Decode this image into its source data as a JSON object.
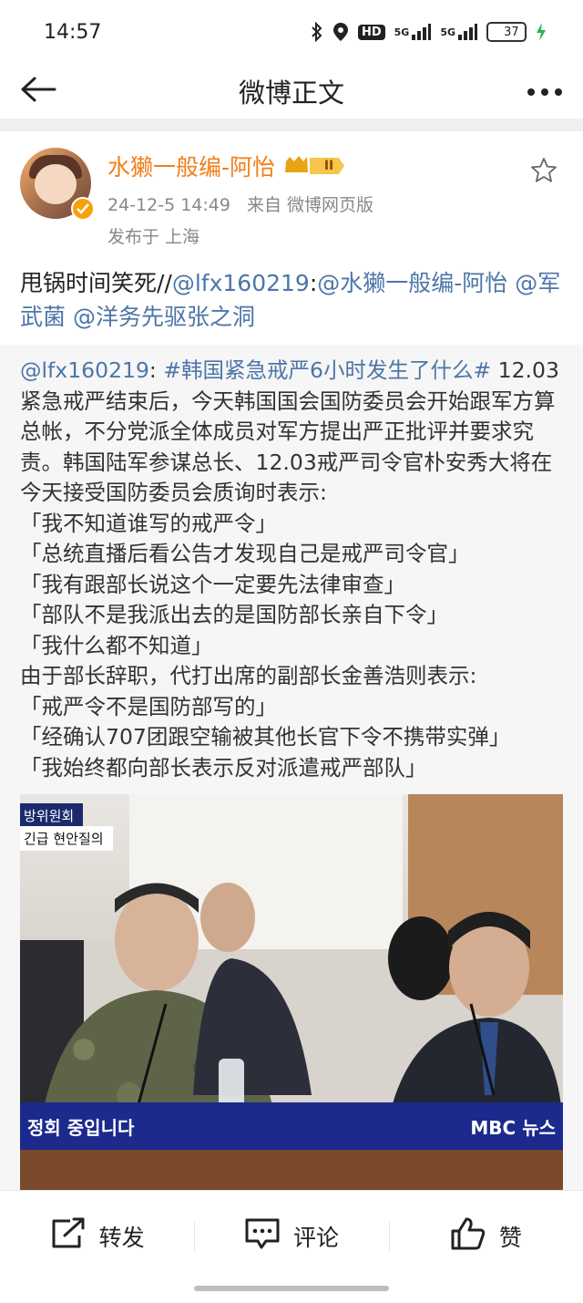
{
  "status_bar": {
    "time": "14:57",
    "hd_label": "HD",
    "net1": "5G",
    "net2": "5G",
    "battery": "37",
    "battery_level_pct": 37
  },
  "nav": {
    "title": "微博正文",
    "back_icon": "back-arrow-icon",
    "more_icon": "more-dots-icon"
  },
  "post": {
    "author_name": "水獭一般编-阿怡",
    "vip_level": "II",
    "timestamp": "24-12-5 14:49",
    "source": "来自 微博网页版",
    "location": "发布于 上海",
    "text_plain": "甩锅时间笑死//",
    "mention1": "@lfx160219",
    "sep1": ":",
    "mention2": "@水獭一般编-阿怡",
    "mention3": "@军武菌",
    "mention4": "@洋务先驱张之洞"
  },
  "repost": {
    "mention": "@lfx160219",
    "colon": ": ",
    "hashtag": "#韩国紧急戒严6小时发生了什么#",
    "body": " 12.03紧急戒严结束后，今天韩国国会国防委员会开始跟军方算总帐，不分党派全体成员对军方提出严正批评并要求究责。韩国陆军参谋总长、12.03戒严司令官朴安秀大将在今天接受国防委员会质询时表示:",
    "quotes1": [
      "「我不知道谁写的戒严令」",
      "「总统直播后看公告才发现自己是戒严司令官」",
      "「我有跟部长说这个一定要先法律审查」",
      "「部队不是我派出去的是国防部长亲自下令」",
      "「我什么都不知道」"
    ],
    "middle": "由于部长辞职，代打出席的副部长金善浩则表示:",
    "quotes2": [
      "「戒严令不是国防部写的」",
      "「经确认707团跟空输被其他长官下令不携带实弹」",
      "「我始终都向部长表示反对派遣戒严部队」"
    ]
  },
  "photo": {
    "tag_top": "방위원회",
    "tag_sub": "긴급 현안질의",
    "caption": "정회 중입니다",
    "broadcaster": "MBC 뉴스"
  },
  "actions": [
    {
      "label": "转发",
      "icon": "repost-icon"
    },
    {
      "label": "评论",
      "icon": "comment-icon"
    },
    {
      "label": "赞",
      "icon": "like-icon"
    }
  ]
}
